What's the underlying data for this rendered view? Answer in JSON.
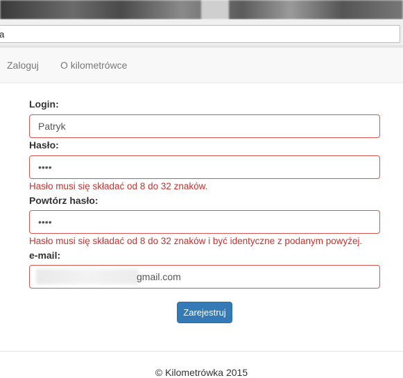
{
  "browser": {
    "address_text": "a"
  },
  "navbar": {
    "items": [
      {
        "label": "Zaloguj"
      },
      {
        "label": "O kilometrówce"
      }
    ]
  },
  "form": {
    "login": {
      "label": "Login:",
      "value": "Patryk"
    },
    "password": {
      "label": "Hasło:",
      "value": "••••",
      "error": "Hasło musi się składać od 8 do 32 znaków."
    },
    "password_repeat": {
      "label": "Powtórz hasło:",
      "value": "••••",
      "error": "Hasło musi się składać od 8 do 32 znaków i być identyczne z podanym powyżej."
    },
    "email": {
      "label": "e-mail:",
      "visible_value": "gmail.com"
    },
    "submit_label": "Zarejestruj"
  },
  "footer": {
    "text": "© Kilometrówka 2015"
  },
  "colors": {
    "error": "#c9302c",
    "field_border_error": "#d9534f",
    "primary_button": "#337ab7",
    "navbar_bg": "#f8f8f8"
  }
}
